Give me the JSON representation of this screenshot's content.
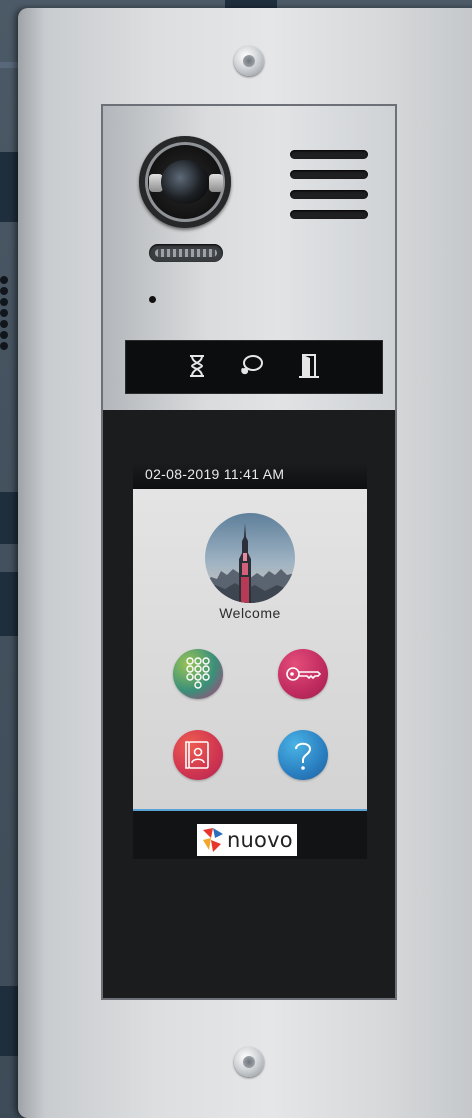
{
  "screen": {
    "datetime": "02-08-2019  11:41 AM",
    "welcome_label": "Welcome",
    "brand": "nuovo"
  },
  "buttons": [
    {
      "name": "keypad",
      "icon": "keypad-icon",
      "color": "#3a8f7a"
    },
    {
      "name": "key",
      "icon": "key-icon",
      "color": "#c02b5f"
    },
    {
      "name": "directory",
      "icon": "contact-book-icon",
      "color": "#cf3550"
    },
    {
      "name": "help",
      "icon": "help-icon",
      "color": "#2a7fc0"
    }
  ],
  "status_icons": [
    "hourglass-icon",
    "talk-icon",
    "door-icon"
  ],
  "colors": {
    "accent_line": "#5aa3d6",
    "panel_dark": "#1a1c1e"
  }
}
